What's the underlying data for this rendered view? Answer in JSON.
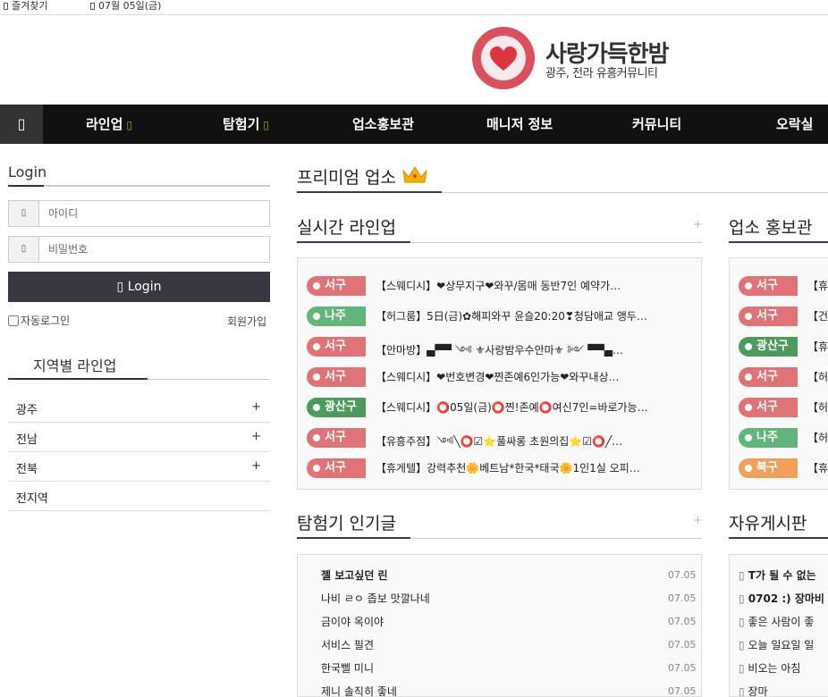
{
  "topbar": {
    "favorites": "즐겨찾기",
    "date": "07월 05일(금)"
  },
  "logo": {
    "title": "사랑가득한밤",
    "subtitle": "광주, 전라 유흥커뮤니티"
  },
  "nav": {
    "home_icon": "home-icon",
    "items": [
      "라인업",
      "탐험기",
      "업소홍보관",
      "매니저 정보",
      "커뮤니티",
      "오락실"
    ]
  },
  "login": {
    "title": "Login",
    "id_placeholder": "아이디",
    "pw_placeholder": "비밀번호",
    "button": "Login",
    "auto_login": "자동로그인",
    "join": "회원가입"
  },
  "region": {
    "title": "지역별 라인업",
    "items": [
      "광주",
      "전남",
      "전북",
      "전지역"
    ],
    "plus": "+"
  },
  "premium": {
    "title": "프리미엄 업소"
  },
  "lineup": {
    "title": "실시간 라인업",
    "plus": "+",
    "rows": [
      {
        "badge": "서구",
        "color": "#e07378",
        "text": "【스웨디시】❤상무지구❤와꾸/몸매 동반7인 예약가…"
      },
      {
        "badge": "나주",
        "color": "#62b57a",
        "text": "【허그룸】5日(금)✿해피와꾸 윤슬20:20❣청담애교 앵두…"
      },
      {
        "badge": "서구",
        "color": "#e07378",
        "text": "【안마방】▄▀▀ ༺ ⚜사랑밤우수안마⚜ ༻ ▀▀▄…"
      },
      {
        "badge": "서구",
        "color": "#e07378",
        "text": "【스웨디시】❤번호변경❤찐존예6인가능❤와꾸내상…"
      },
      {
        "badge": "광산구",
        "color": "#4e9a5e",
        "text": "【스웨디시】⭕05일(금)⭕찐!존예⭕여신7인=바로가능…"
      },
      {
        "badge": "서구",
        "color": "#e07378",
        "text": "【유흥주점】༺╲⭕☑⭐풀싸롱 초원의집⭐☑⭕╱…"
      },
      {
        "badge": "서구",
        "color": "#e07378",
        "text": "【휴게텔】강력추천🌼베트남*한국*태국🌼1인1실 오피…"
      }
    ]
  },
  "promo": {
    "title": "업소 홍보관",
    "rows": [
      {
        "badge": "서구",
        "color": "#e07378",
        "text": "【휴게텔】"
      },
      {
        "badge": "서구",
        "color": "#e07378",
        "text": "【건마】"
      },
      {
        "badge": "광산구",
        "color": "#4e9a5e",
        "text": "【휴게텔】"
      },
      {
        "badge": "서구",
        "color": "#e07378",
        "text": "【허그룸】"
      },
      {
        "badge": "서구",
        "color": "#e07378",
        "text": "【허그룸】"
      },
      {
        "badge": "나주",
        "color": "#62b57a",
        "text": "【허그룸】"
      },
      {
        "badge": "북구",
        "color": "#f0a05a",
        "text": "【휴게텔】"
      }
    ]
  },
  "popular": {
    "title": "탐험기 인기글",
    "plus": "+",
    "posts": [
      {
        "title": "젤 보고싶던 린",
        "date": "07.05",
        "bold": true
      },
      {
        "title": "나비 ㄹㅇ 좁보 맛깔나네",
        "date": "07.05",
        "bold": false
      },
      {
        "title": "금이야 옥이야",
        "date": "07.05",
        "bold": false
      },
      {
        "title": "서비스 필견",
        "date": "07.05",
        "bold": false
      },
      {
        "title": "한국삘 미니",
        "date": "07.05",
        "bold": false
      },
      {
        "title": "제니 솔직히 좋네",
        "date": "07.05",
        "bold": false
      }
    ]
  },
  "freeboard": {
    "title": "자유게시판",
    "posts": [
      {
        "title": "T가 될 수 없는",
        "bold": true
      },
      {
        "title": "0702 :) 장마비",
        "bold": true
      },
      {
        "title": "좋은 사람이 좋",
        "bold": false
      },
      {
        "title": "오늘 일요일 일",
        "bold": false
      },
      {
        "title": "비오는 아침",
        "bold": false
      },
      {
        "title": "장마",
        "bold": false
      }
    ]
  }
}
